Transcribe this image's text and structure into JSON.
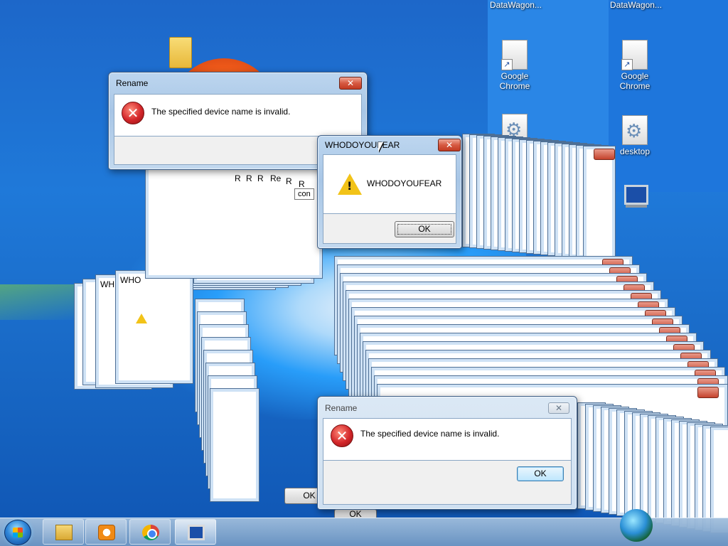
{
  "desktop": {
    "top_labels": [
      "DataWagon...",
      "DataWagon..."
    ],
    "icons": [
      {
        "label": "Google\nChrome",
        "icon": "shortcut-icon"
      },
      {
        "label": "Google\nChrome",
        "icon": "shortcut-icon"
      },
      {
        "label": "desktop",
        "icon": "gear-file-icon"
      }
    ]
  },
  "dialogs": {
    "rename_top": {
      "title": "Rename",
      "message": "The specified device name is invalid.",
      "close": "✕"
    },
    "whodoyoufear": {
      "title": "WHODOYOUFEAR",
      "message": "WHODOYOUFEAR",
      "ok": "OK",
      "close": "✕"
    },
    "rename_bottom": {
      "title": "Rename",
      "message": "The specified device name is invalid.",
      "ok": "OK",
      "close": "✕"
    }
  },
  "tooltip": "con",
  "cascade_fragments": {
    "r_labels": [
      "R",
      "R",
      "R",
      "Re",
      "R",
      "R"
    ],
    "wh": "WH",
    "who": "WHO",
    "ok1": "OK",
    "ok2": "OK"
  },
  "taskbar": {
    "items": [
      "windows-explorer",
      "media-player",
      "google-chrome",
      "computer"
    ],
    "active": "computer"
  },
  "colors": {
    "accent": "#1f79d9",
    "close_red": "#c4422c",
    "warning": "#f2c318"
  }
}
